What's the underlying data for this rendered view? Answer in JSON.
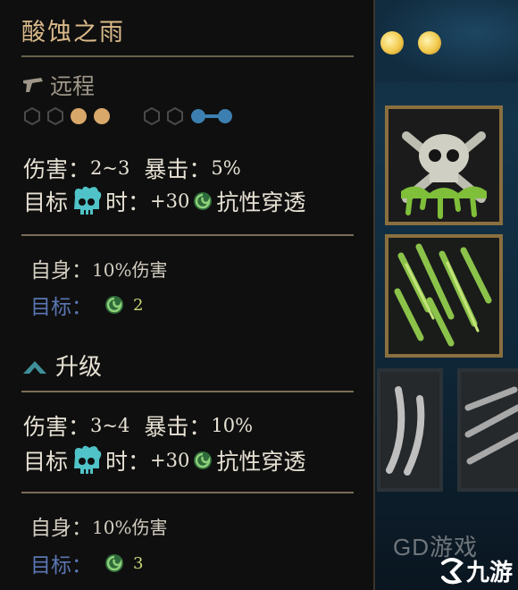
{
  "skill": {
    "title": "酸蚀之雨",
    "category": "远程",
    "category_icon": "pistol-icon",
    "pips": {
      "rank": [
        "empty",
        "empty",
        "filled",
        "filled"
      ],
      "target": [
        "empty",
        "empty",
        "linked",
        "linked"
      ],
      "filled_color": "#d8a86a",
      "linked_color": "#3c7fb0"
    },
    "base": {
      "damage_label": "伤害：",
      "damage_value": "2~3",
      "crit_label": "暴击：",
      "crit_value": "5%",
      "target_prefix": "目标",
      "target_suffix": "时：",
      "bonus_value": "+30",
      "bonus_label": "抗性穿透",
      "self_label": "自身：",
      "self_value": "10%伤害",
      "target_label": "目标：",
      "target_stack": "2"
    },
    "upgrade": {
      "heading": "升级",
      "damage_label": "伤害：",
      "damage_value": "3~4",
      "crit_label": "暴击：",
      "crit_value": "10%",
      "target_prefix": "目标",
      "target_suffix": "时：",
      "bonus_value": "+30",
      "bonus_label": "抗性穿透",
      "self_label": "自身：",
      "self_value": "10%伤害",
      "target_label": "目标：",
      "target_stack": "3"
    }
  },
  "scene": {
    "watermark": "GD游戏",
    "logo": "九游"
  },
  "colors": {
    "title": "#d9b98a",
    "gold_frame": "#8a6f3f",
    "target_blue": "#5a77b3",
    "acid_green": "#7fbf3a"
  }
}
